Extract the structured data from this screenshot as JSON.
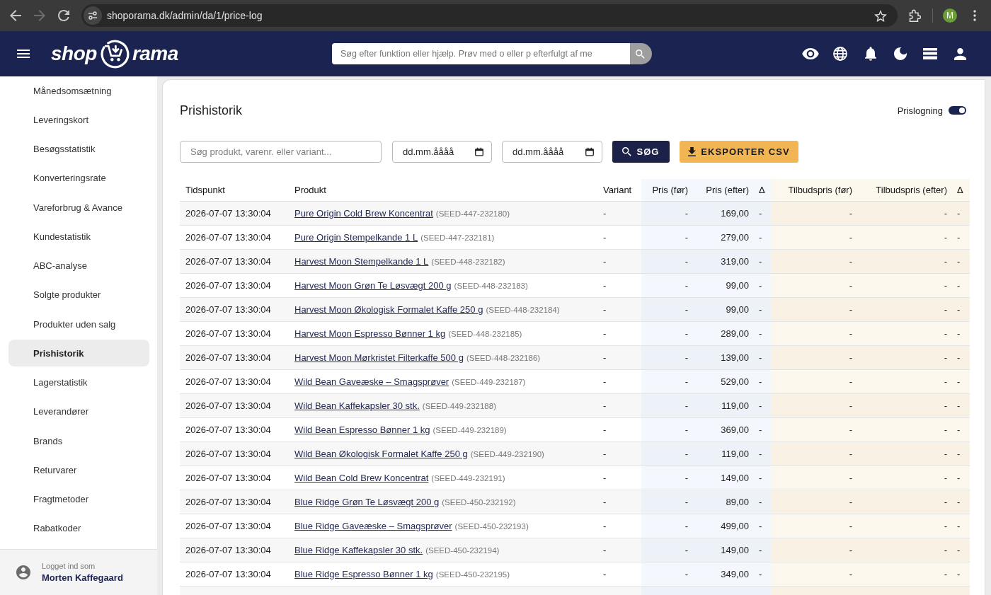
{
  "browser": {
    "nav": [
      {
        "kind": "back",
        "disabled": false
      },
      {
        "kind": "forward",
        "disabled": true
      },
      {
        "kind": "reload",
        "disabled": false
      }
    ],
    "url": "shoporama.dk/admin/da/1/price-log",
    "profile_initial": "M"
  },
  "header": {
    "logo": {
      "left": "shop",
      "right": "rama"
    },
    "search": {
      "placeholder": "Søg efter funktion eller hjælp. Prøv med o eller p efterfulgt af me"
    }
  },
  "sidebar": {
    "items": [
      {
        "label": "Månedsomsætning",
        "selected": false
      },
      {
        "label": "Leveringskort",
        "selected": false
      },
      {
        "label": "Besøgsstatistik",
        "selected": false
      },
      {
        "label": "Konverteringsrate",
        "selected": false
      },
      {
        "label": "Vareforbrug & Avance",
        "selected": false
      },
      {
        "label": "Kundestatistik",
        "selected": false
      },
      {
        "label": "ABC-analyse",
        "selected": false
      },
      {
        "label": "Solgte produkter",
        "selected": false
      },
      {
        "label": "Produkter uden salg",
        "selected": false
      },
      {
        "label": "Prishistorik",
        "selected": true
      },
      {
        "label": "Lagerstatistik",
        "selected": false
      },
      {
        "label": "Leverandører",
        "selected": false
      },
      {
        "label": "Brands",
        "selected": false
      },
      {
        "label": "Returvarer",
        "selected": false
      },
      {
        "label": "Fragtmetoder",
        "selected": false
      },
      {
        "label": "Rabatkoder",
        "selected": false
      }
    ],
    "user": {
      "caption": "Logget ind som",
      "name": "Morten Kaffegaard"
    }
  },
  "page": {
    "title": "Prishistorik",
    "price_logging": {
      "label": "Prislogning",
      "on": true
    },
    "filters": {
      "search": {
        "placeholder": "Søg produkt, varenr. eller variant..."
      },
      "date_from": {
        "placeholder": "dd.mm.åååå"
      },
      "date_to": {
        "placeholder": "dd.mm.åååå"
      },
      "search_button": {
        "label": "SØG"
      },
      "export_button": {
        "label": "EKSPORTER CSV"
      }
    },
    "table": {
      "columns": [
        {
          "label": "Tidspunkt",
          "kind": "time"
        },
        {
          "label": "Produkt",
          "kind": "product"
        },
        {
          "label": "Variant",
          "kind": "text"
        },
        {
          "label": "Pris (før)",
          "kind": "price"
        },
        {
          "label": "Pris (efter)",
          "kind": "price"
        },
        {
          "label": "Δ",
          "kind": "price_delta"
        },
        {
          "label": "Tilbudspris (før)",
          "kind": "offer"
        },
        {
          "label": "Tilbudspris (efter)",
          "kind": "offer"
        },
        {
          "label": "Δ",
          "kind": "offer_delta"
        }
      ],
      "rows": [
        {
          "cells": [
            "2026-07-07 13:30:04",
            {
              "name": "Pure Origin Cold Brew Koncentrat",
              "sku": "(SEED-447-232180)"
            },
            "-",
            "-",
            "169,00",
            "-",
            "-",
            "-",
            "-"
          ]
        },
        {
          "cells": [
            "2026-07-07 13:30:04",
            {
              "name": "Pure Origin Stempelkande 1 L",
              "sku": "(SEED-447-232181)"
            },
            "-",
            "-",
            "279,00",
            "-",
            "-",
            "-",
            "-"
          ]
        },
        {
          "cells": [
            "2026-07-07 13:30:04",
            {
              "name": "Harvest Moon Stempelkande 1 L",
              "sku": "(SEED-448-232182)"
            },
            "-",
            "-",
            "319,00",
            "-",
            "-",
            "-",
            "-"
          ]
        },
        {
          "cells": [
            "2026-07-07 13:30:04",
            {
              "name": "Harvest Moon Grøn Te Løsvægt 200 g",
              "sku": "(SEED-448-232183)"
            },
            "-",
            "-",
            "99,00",
            "-",
            "-",
            "-",
            "-"
          ]
        },
        {
          "cells": [
            "2026-07-07 13:30:04",
            {
              "name": "Harvest Moon Økologisk Formalet Kaffe 250 g",
              "sku": "(SEED-448-232184)"
            },
            "-",
            "-",
            "99,00",
            "-",
            "-",
            "-",
            "-"
          ]
        },
        {
          "cells": [
            "2026-07-07 13:30:04",
            {
              "name": "Harvest Moon Espresso Bønner 1 kg",
              "sku": "(SEED-448-232185)"
            },
            "-",
            "-",
            "289,00",
            "-",
            "-",
            "-",
            "-"
          ]
        },
        {
          "cells": [
            "2026-07-07 13:30:04",
            {
              "name": "Harvest Moon Mørkristet Filterkaffe 500 g",
              "sku": "(SEED-448-232186)"
            },
            "-",
            "-",
            "139,00",
            "-",
            "-",
            "-",
            "-"
          ]
        },
        {
          "cells": [
            "2026-07-07 13:30:04",
            {
              "name": "Wild Bean Gaveæske – Smagsprøver",
              "sku": "(SEED-449-232187)"
            },
            "-",
            "-",
            "529,00",
            "-",
            "-",
            "-",
            "-"
          ]
        },
        {
          "cells": [
            "2026-07-07 13:30:04",
            {
              "name": "Wild Bean Kaffekapsler 30 stk.",
              "sku": "(SEED-449-232188)"
            },
            "-",
            "-",
            "119,00",
            "-",
            "-",
            "-",
            "-"
          ]
        },
        {
          "cells": [
            "2026-07-07 13:30:04",
            {
              "name": "Wild Bean Espresso Bønner 1 kg",
              "sku": "(SEED-449-232189)"
            },
            "-",
            "-",
            "369,00",
            "-",
            "-",
            "-",
            "-"
          ]
        },
        {
          "cells": [
            "2026-07-07 13:30:04",
            {
              "name": "Wild Bean Økologisk Formalet Kaffe 250 g",
              "sku": "(SEED-449-232190)"
            },
            "-",
            "-",
            "119,00",
            "-",
            "-",
            "-",
            "-"
          ]
        },
        {
          "cells": [
            "2026-07-07 13:30:04",
            {
              "name": "Wild Bean Cold Brew Koncentrat",
              "sku": "(SEED-449-232191)"
            },
            "-",
            "-",
            "149,00",
            "-",
            "-",
            "-",
            "-"
          ]
        },
        {
          "cells": [
            "2026-07-07 13:30:04",
            {
              "name": "Blue Ridge Grøn Te Løsvægt 200 g",
              "sku": "(SEED-450-232192)"
            },
            "-",
            "-",
            "89,00",
            "-",
            "-",
            "-",
            "-"
          ]
        },
        {
          "cells": [
            "2026-07-07 13:30:04",
            {
              "name": "Blue Ridge Gaveæske – Smagsprøver",
              "sku": "(SEED-450-232193)"
            },
            "-",
            "-",
            "499,00",
            "-",
            "-",
            "-",
            "-"
          ]
        },
        {
          "cells": [
            "2026-07-07 13:30:04",
            {
              "name": "Blue Ridge Kaffekapsler 30 stk.",
              "sku": "(SEED-450-232194)"
            },
            "-",
            "-",
            "149,00",
            "-",
            "-",
            "-",
            "-"
          ]
        },
        {
          "cells": [
            "2026-07-07 13:30:04",
            {
              "name": "Blue Ridge Espresso Bønner 1 kg",
              "sku": "(SEED-450-232195)"
            },
            "-",
            "-",
            "349,00",
            "-",
            "-",
            "-",
            "-"
          ]
        }
      ]
    }
  }
}
